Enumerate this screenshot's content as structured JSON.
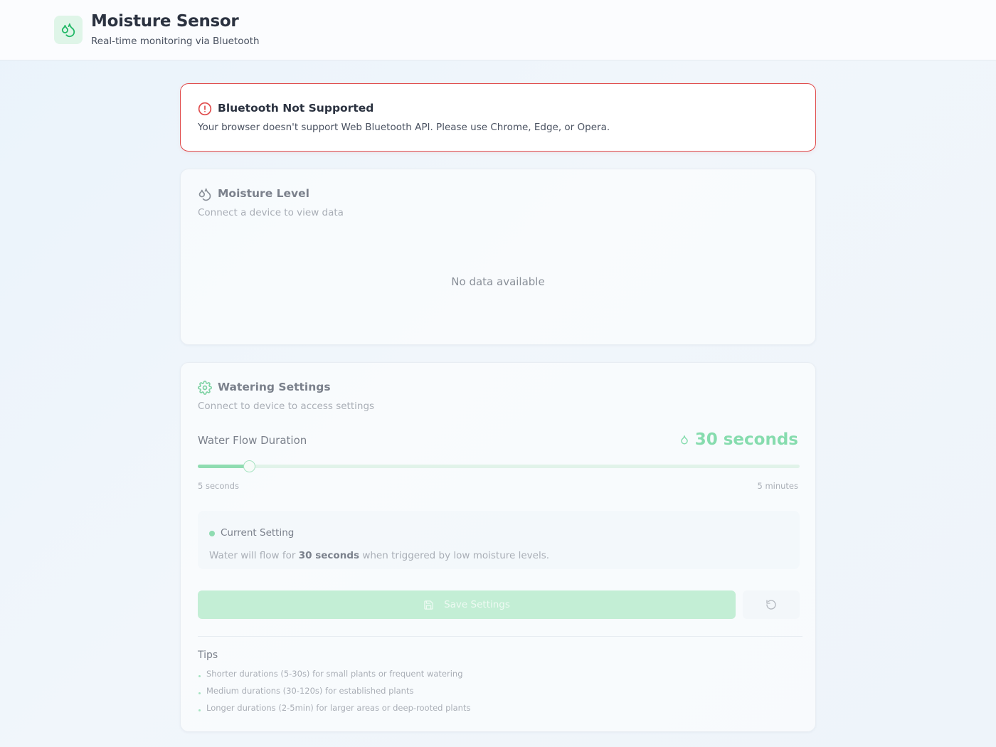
{
  "header": {
    "title": "Moisture Sensor",
    "subtitle": "Real-time monitoring via Bluetooth",
    "logo_icon": "droplets-icon"
  },
  "alert": {
    "icon": "alert-circle-icon",
    "title": "Bluetooth Not Supported",
    "message": "Your browser doesn't support Web Bluetooth API. Please use Chrome, Edge, or Opera.",
    "color": "#e04a4a"
  },
  "moisture": {
    "icon": "droplets-icon",
    "title": "Moisture Level",
    "subtitle": "Connect a device to view data",
    "empty_message": "No data available"
  },
  "settings": {
    "icon": "gear-icon",
    "title": "Watering Settings",
    "subtitle": "Connect to device to access settings",
    "flow_label": "Water Flow Duration",
    "flow_value": "30 seconds",
    "slider": {
      "min_label": "5 seconds",
      "max_label": "5 minutes",
      "min_seconds": 5,
      "max_seconds": 300,
      "value_seconds": 30
    },
    "current": {
      "title": "Current Setting",
      "prefix": "Water will flow for",
      "value": "30 seconds",
      "suffix": "when triggered by low moisture levels."
    },
    "save_label": "Save Settings",
    "reset_icon": "reset-icon",
    "tips_title": " Tips",
    "tips": [
      "Shorter durations (5-30s) for small plants or frequent watering",
      "Medium durations (30-120s) for established plants",
      "Longer durations (2-5min) for larger areas or deep-rooted plants"
    ],
    "accent": "#86dcae"
  }
}
